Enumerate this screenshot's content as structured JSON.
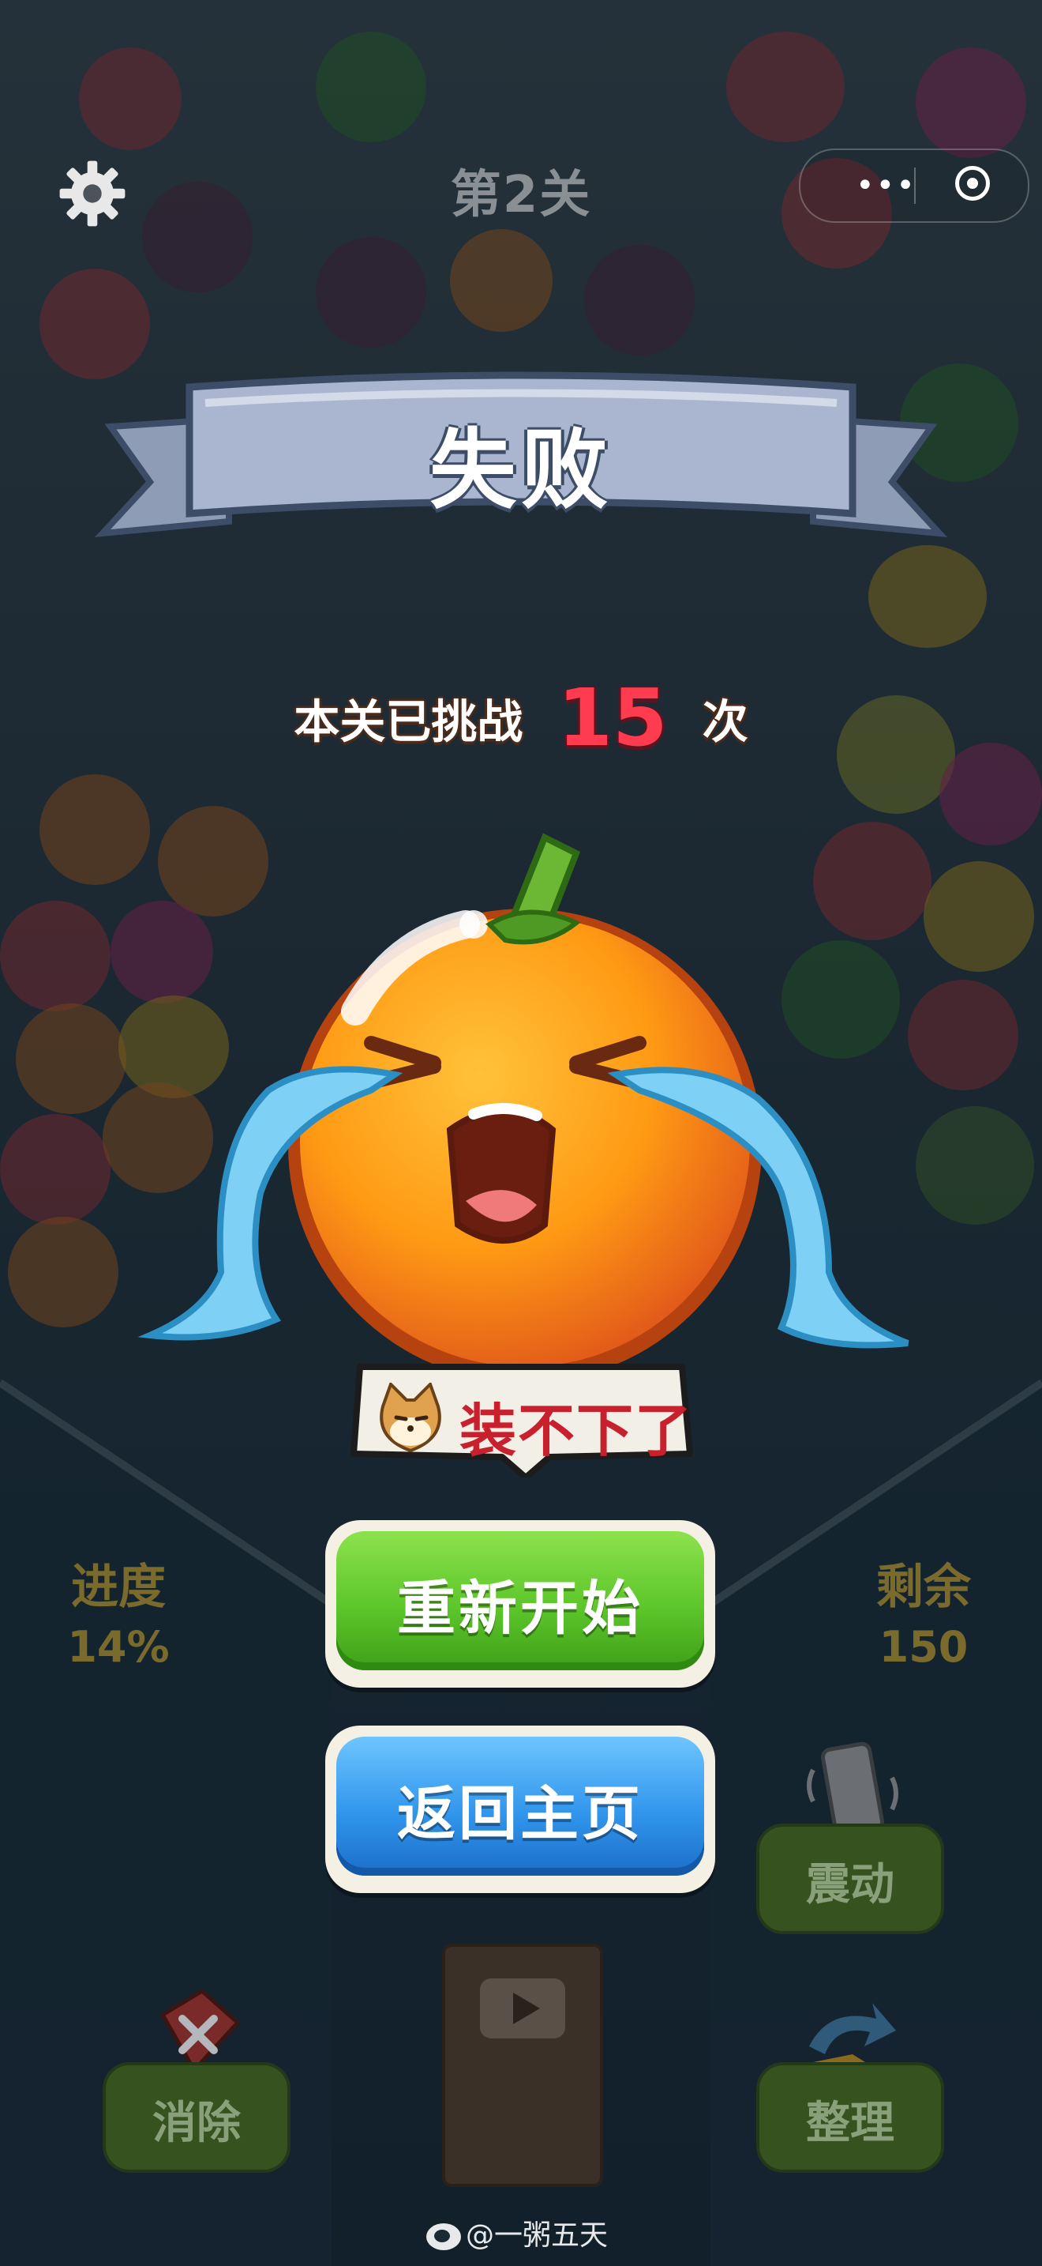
{
  "header": {
    "level_title": "第2关"
  },
  "result": {
    "banner_title": "失败",
    "challenge_prefix": "本关已挑战",
    "challenge_count": "15",
    "challenge_suffix": "次",
    "bubble_text": "装不下了"
  },
  "buttons": {
    "restart_label": "重新开始",
    "home_label": "返回主页"
  },
  "stats": {
    "progress_label": "进度",
    "progress_value": "14%",
    "remaining_label": "剩余",
    "remaining_value": "150"
  },
  "tools": {
    "vibrate_label": "震动",
    "remove_label": "消除",
    "sort_label": "整理"
  },
  "watermark": {
    "text": "@一粥五天"
  },
  "icons": {
    "settings": "gear-icon",
    "more": "more-dots-icon",
    "close": "target-icon",
    "video": "video-icon"
  },
  "colors": {
    "restart": "#5cc62a",
    "home": "#3196ec",
    "challenge_count": "#ff3b4f",
    "bubble_text": "#c8202c"
  }
}
